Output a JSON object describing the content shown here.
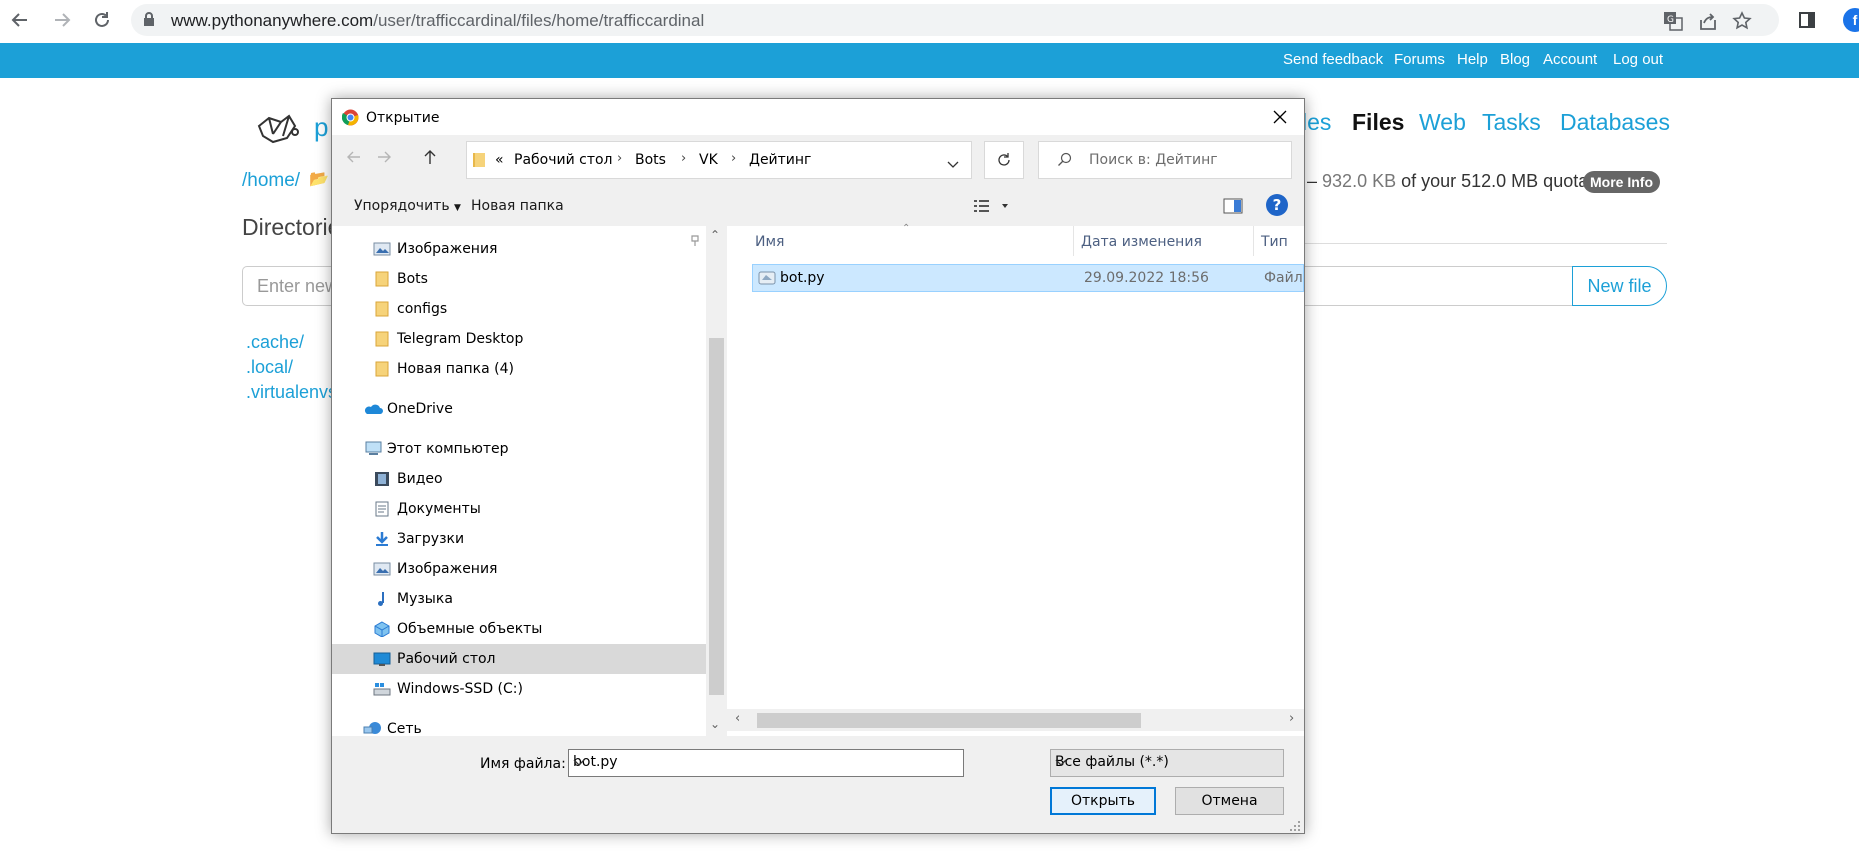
{
  "browser": {
    "url_host": "www.pythonanywhere.com",
    "url_path": "/user/trafficcardinal/files/home/trafficcardinal",
    "profile_initial": "f"
  },
  "pa": {
    "top_links": [
      "Send feedback",
      "Forums",
      "Help",
      "Blog",
      "Account",
      "Log out"
    ],
    "brand_fragment": "p",
    "nav": {
      "consoles_fragment": "les",
      "files": "Files",
      "web": "Web",
      "tasks": "Tasks",
      "databases": "Databases"
    },
    "breadcrumb_home": "/home/",
    "quota_dash": "–",
    "quota_used": "932.0 KB",
    "quota_text": "of your 512.0 MB quota",
    "more_info": "More Info",
    "directories_heading": "Directorie",
    "dir_input_placeholder": "Enter new",
    "new_file_button": "New file",
    "dirs": [
      ".cache/",
      ".local/",
      ".virtualenvs"
    ]
  },
  "dialog": {
    "title": "Открытие",
    "breadcrumb_prefix": "«",
    "breadcrumb": [
      "Рабочий стол",
      "Bots",
      "VK",
      "Дейтинг"
    ],
    "search_placeholder": "Поиск в: Дейтинг",
    "organize": "Упорядочить",
    "new_folder": "Новая папка",
    "help": "?",
    "nav_items": [
      {
        "label": "Изображения",
        "icon": "pictures-icon"
      },
      {
        "label": "Bots",
        "icon": "folder-icon"
      },
      {
        "label": "configs",
        "icon": "folder-icon"
      },
      {
        "label": "Telegram Desktop",
        "icon": "folder-icon"
      },
      {
        "label": "Новая папка (4)",
        "icon": "folder-icon"
      },
      {
        "label": "OneDrive",
        "icon": "onedrive-icon"
      },
      {
        "label": "Этот компьютер",
        "icon": "computer-icon"
      },
      {
        "label": "Видео",
        "icon": "video-icon"
      },
      {
        "label": "Документы",
        "icon": "documents-icon"
      },
      {
        "label": "Загрузки",
        "icon": "downloads-icon"
      },
      {
        "label": "Изображения",
        "icon": "pictures-icon"
      },
      {
        "label": "Музыка",
        "icon": "music-icon"
      },
      {
        "label": "Объемные объекты",
        "icon": "3d-objects-icon"
      },
      {
        "label": "Рабочий стол",
        "icon": "desktop-icon"
      },
      {
        "label": "Windows-SSD (C:)",
        "icon": "drive-icon"
      },
      {
        "label": "Сеть",
        "icon": "network-icon"
      }
    ],
    "columns": {
      "name": "Имя",
      "modified": "Дата изменения",
      "type": "Тип"
    },
    "files": [
      {
        "name": "bot.py",
        "modified": "29.09.2022 18:56",
        "type": "Файл \""
      }
    ],
    "filename_label": "Имя файла:",
    "filename_value": "bot.py",
    "filetype_value": "Все файлы (*.*)",
    "open_button": "Открыть",
    "cancel_button": "Отмена"
  },
  "colors": {
    "pa_blue": "#1ca0d7",
    "selection": "#cce8ff",
    "win_accent": "#0078d7"
  }
}
